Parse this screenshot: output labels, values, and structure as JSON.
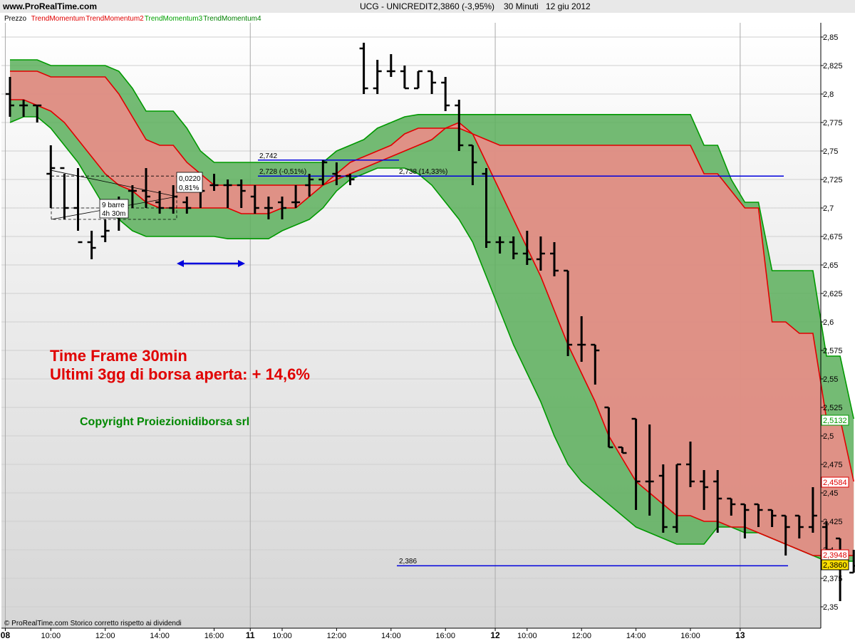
{
  "header": {
    "site": "www.ProRealTime.com",
    "title": "UCG - UNICREDIT",
    "price_info": "2,3860 (-3,95%)",
    "timeframe": "30 Minuti",
    "date": "12 giu 2012"
  },
  "legend": [
    {
      "name": "Prezzo",
      "color": "#000000"
    },
    {
      "name": "TrendMomentum",
      "color": "#e00000"
    },
    {
      "name": "TrendMomentum2",
      "color": "#e00000"
    },
    {
      "name": "TrendMomentum3",
      "color": "#00a000"
    },
    {
      "name": "TrendMomentum4",
      "color": "#008000"
    }
  ],
  "annotations": {
    "headline1": "Time Frame 30min",
    "headline2": "Ultimi 3gg di borsa aperta: + 14,6%",
    "copyright": "Copyright Proiezionidiborsa srl",
    "footer": "© ProRealTime.com  Storico corretto rispetto ai dividendi",
    "box_a": "0,0220",
    "box_b": "0,81%",
    "box_c": "9 barre",
    "box_d": "4h 30m",
    "lbl_2742": "2,742",
    "lbl_2728": "2,728 (-0,51%)",
    "lbl_2738": "2,738 (14,33%)",
    "lbl_2386": "2,386"
  },
  "price_tags": {
    "green": "2,5132",
    "red": "2,4584",
    "red2": "2,3948",
    "last": "2,3860"
  },
  "colors": {
    "red_fill": "#f28a8a",
    "green_fill": "#5caf5c",
    "red_line": "#e00000",
    "green_line": "#009900",
    "blue": "#0000dd",
    "text_red": "#e00000",
    "text_green": "#008800"
  },
  "chart_data": {
    "type": "bar",
    "title": "UCG - UNICREDIT",
    "ylim": [
      2.335,
      2.865
    ],
    "y_ticks": [
      "2,35",
      "2,375",
      "2,4",
      "2,425",
      "2,45",
      "2,475",
      "2,5",
      "2,525",
      "2,55",
      "2,575",
      "2,6",
      "2,625",
      "2,65",
      "2,675",
      "2,7",
      "2,725",
      "2,75",
      "2,775",
      "2,8",
      "2,825",
      "2,85"
    ],
    "x_ticks": [
      {
        "bar": 0,
        "label": "08",
        "day": true
      },
      {
        "bar": 3,
        "label": "10:00",
        "day": false
      },
      {
        "bar": 7,
        "label": "12:00",
        "day": false
      },
      {
        "bar": 11,
        "label": "14:00",
        "day": false
      },
      {
        "bar": 15,
        "label": "16:00",
        "day": false
      },
      {
        "bar": 18,
        "label": "11",
        "day": true
      },
      {
        "bar": 20,
        "label": "10:00",
        "day": false
      },
      {
        "bar": 24,
        "label": "12:00",
        "day": false
      },
      {
        "bar": 28,
        "label": "14:00",
        "day": false
      },
      {
        "bar": 32,
        "label": "16:00",
        "day": false
      },
      {
        "bar": 36,
        "label": "12",
        "day": true
      },
      {
        "bar": 38,
        "label": "10:00",
        "day": false
      },
      {
        "bar": 42,
        "label": "12:00",
        "day": false
      },
      {
        "bar": 46,
        "label": "14:00",
        "day": false
      },
      {
        "bar": 50,
        "label": "16:00",
        "day": false
      },
      {
        "bar": 54,
        "label": "13",
        "day": true
      }
    ],
    "ohlc": [
      [
        2.8,
        2.815,
        2.78,
        2.79
      ],
      [
        2.79,
        2.795,
        2.78,
        2.79
      ],
      [
        2.79,
        2.79,
        2.775,
        2.79
      ],
      [
        2.73,
        2.755,
        2.7,
        2.735
      ],
      [
        2.735,
        2.73,
        2.69,
        2.7
      ],
      [
        2.7,
        2.735,
        2.68,
        2.67
      ],
      [
        2.67,
        2.68,
        2.655,
        2.665
      ],
      [
        2.675,
        2.69,
        2.67,
        2.68
      ],
      [
        2.7,
        2.71,
        2.68,
        2.7
      ],
      [
        2.715,
        2.72,
        2.7,
        2.715
      ],
      [
        2.715,
        2.735,
        2.7,
        2.71
      ],
      [
        2.705,
        2.715,
        2.695,
        2.7
      ],
      [
        2.7,
        2.72,
        2.695,
        2.71
      ],
      [
        2.705,
        2.71,
        2.695,
        2.7
      ],
      [
        2.72,
        2.72,
        2.7,
        2.715
      ],
      [
        2.72,
        2.73,
        2.715,
        2.72
      ],
      [
        2.72,
        2.725,
        2.7,
        2.72
      ],
      [
        2.72,
        2.725,
        2.7,
        2.715
      ],
      [
        2.71,
        2.72,
        2.695,
        2.7
      ],
      [
        2.7,
        2.71,
        2.69,
        2.7
      ],
      [
        2.705,
        2.71,
        2.69,
        2.7
      ],
      [
        2.705,
        2.72,
        2.7,
        2.705
      ],
      [
        2.72,
        2.73,
        2.71,
        2.725
      ],
      [
        2.725,
        2.742,
        2.72,
        2.74
      ],
      [
        2.73,
        2.74,
        2.72,
        2.728
      ],
      [
        2.728,
        2.73,
        2.72,
        2.725
      ],
      [
        2.84,
        2.845,
        2.8,
        2.805
      ],
      [
        2.805,
        2.83,
        2.8,
        2.82
      ],
      [
        2.82,
        2.835,
        2.815,
        2.82
      ],
      [
        2.82,
        2.825,
        2.805,
        2.805
      ],
      [
        2.805,
        2.82,
        2.805,
        2.82
      ],
      [
        2.82,
        2.82,
        2.8,
        2.81
      ],
      [
        2.81,
        2.815,
        2.785,
        2.79
      ],
      [
        2.79,
        2.795,
        2.75,
        2.755
      ],
      [
        2.755,
        2.755,
        2.72,
        2.74
      ],
      [
        2.73,
        2.735,
        2.665,
        2.67
      ],
      [
        2.67,
        2.675,
        2.66,
        2.67
      ],
      [
        2.67,
        2.675,
        2.655,
        2.66
      ],
      [
        2.66,
        2.68,
        2.65,
        2.655
      ],
      [
        2.655,
        2.675,
        2.645,
        2.66
      ],
      [
        2.66,
        2.67,
        2.64,
        2.645
      ],
      [
        2.645,
        2.645,
        2.57,
        2.58
      ],
      [
        2.58,
        2.605,
        2.565,
        2.58
      ],
      [
        2.58,
        2.58,
        2.545,
        2.575
      ],
      [
        2.525,
        2.525,
        2.49,
        2.49
      ],
      [
        2.49,
        2.49,
        2.485,
        2.485
      ],
      [
        2.515,
        2.515,
        2.435,
        2.46
      ],
      [
        2.46,
        2.51,
        2.43,
        2.46
      ],
      [
        2.465,
        2.475,
        2.415,
        2.42
      ],
      [
        2.42,
        2.475,
        2.415,
        2.475
      ],
      [
        2.475,
        2.495,
        2.455,
        2.46
      ],
      [
        2.46,
        2.47,
        2.435,
        2.455
      ],
      [
        2.46,
        2.47,
        2.415,
        2.445
      ],
      [
        2.445,
        2.445,
        2.43,
        2.44
      ],
      [
        2.44,
        2.44,
        2.41,
        2.435
      ],
      [
        2.44,
        2.44,
        2.42,
        2.435
      ],
      [
        2.435,
        2.435,
        2.42,
        2.43
      ],
      [
        2.43,
        2.43,
        2.395,
        2.42
      ],
      [
        2.43,
        2.43,
        2.41,
        2.42
      ],
      [
        2.42,
        2.455,
        2.415,
        2.43
      ],
      [
        2.42,
        2.425,
        2.39,
        2.4
      ],
      [
        2.41,
        2.41,
        2.355,
        2.39
      ],
      [
        2.38,
        2.4,
        2.38,
        2.386
      ]
    ],
    "band_outer_upper": [
      2.83,
      2.83,
      2.83,
      2.825,
      2.825,
      2.825,
      2.825,
      2.825,
      2.82,
      2.805,
      2.785,
      2.785,
      2.785,
      2.77,
      2.75,
      2.74,
      2.74,
      2.74,
      2.74,
      2.74,
      2.74,
      2.74,
      2.74,
      2.74,
      2.75,
      2.755,
      2.76,
      2.77,
      2.775,
      2.78,
      2.782,
      2.782,
      2.782,
      2.782,
      2.782,
      2.782,
      2.782,
      2.782,
      2.782,
      2.782,
      2.782,
      2.782,
      2.782,
      2.782,
      2.782,
      2.782,
      2.782,
      2.782,
      2.782,
      2.782,
      2.782,
      2.755,
      2.755,
      2.725,
      2.705,
      2.705,
      2.645,
      2.645,
      2.645,
      2.645,
      2.57,
      2.57,
      2.515
    ],
    "band_red_upper": [
      2.82,
      2.82,
      2.82,
      2.815,
      2.815,
      2.815,
      2.815,
      2.815,
      2.8,
      2.78,
      2.76,
      2.755,
      2.755,
      2.74,
      2.73,
      2.72,
      2.72,
      2.72,
      2.72,
      2.72,
      2.72,
      2.72,
      2.72,
      2.72,
      2.73,
      2.74,
      2.745,
      2.75,
      2.755,
      2.765,
      2.77,
      2.77,
      2.77,
      2.77,
      2.765,
      2.76,
      2.755,
      2.755,
      2.755,
      2.755,
      2.755,
      2.755,
      2.755,
      2.755,
      2.755,
      2.755,
      2.755,
      2.755,
      2.755,
      2.755,
      2.755,
      2.73,
      2.73,
      2.715,
      2.7,
      2.7,
      2.6,
      2.6,
      2.59,
      2.59,
      2.515,
      2.515,
      2.46
    ],
    "band_red_lower": [
      2.795,
      2.795,
      2.79,
      2.785,
      2.775,
      2.76,
      2.745,
      2.73,
      2.72,
      2.715,
      2.705,
      2.7,
      2.7,
      2.7,
      2.7,
      2.7,
      2.7,
      2.695,
      2.695,
      2.695,
      2.7,
      2.7,
      2.71,
      2.72,
      2.725,
      2.73,
      2.735,
      2.74,
      2.745,
      2.75,
      2.755,
      2.76,
      2.77,
      2.775,
      2.765,
      2.74,
      2.715,
      2.69,
      2.665,
      2.64,
      2.61,
      2.58,
      2.555,
      2.53,
      2.5,
      2.48,
      2.46,
      2.45,
      2.44,
      2.43,
      2.43,
      2.425,
      2.425,
      2.42,
      2.42,
      2.415,
      2.41,
      2.405,
      2.4,
      2.395,
      2.395,
      2.395,
      2.395
    ],
    "band_outer_lower": [
      2.775,
      2.78,
      2.78,
      2.77,
      2.755,
      2.74,
      2.72,
      2.7,
      2.69,
      2.68,
      2.675,
      2.675,
      2.675,
      2.675,
      2.675,
      2.675,
      2.673,
      2.673,
      2.673,
      2.673,
      2.68,
      2.685,
      2.69,
      2.7,
      2.715,
      2.725,
      2.73,
      2.735,
      2.735,
      2.735,
      2.73,
      2.72,
      2.705,
      2.69,
      2.67,
      2.64,
      2.61,
      2.58,
      2.555,
      2.53,
      2.5,
      2.475,
      2.46,
      2.45,
      2.44,
      2.43,
      2.42,
      2.415,
      2.41,
      2.405,
      2.405,
      2.405,
      2.42,
      2.42,
      2.415,
      2.415,
      2.41,
      2.405,
      2.4,
      2.395,
      2.39,
      2.39,
      2.39
    ]
  }
}
